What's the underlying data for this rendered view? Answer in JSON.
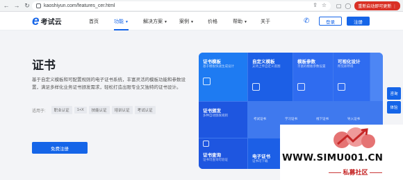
{
  "browser": {
    "url": "kaoshiyun.com/features_cer.html",
    "relaunch_label": "重新启动即可更新 ⋮"
  },
  "header": {
    "logo_mark": "e",
    "logo_text": "考试云",
    "nav": [
      "首页",
      "功能",
      "解决方案",
      "案例",
      "价格",
      "帮助",
      "关于"
    ],
    "active_nav": "功能",
    "login_label": "登录",
    "register_label": "注册"
  },
  "hero": {
    "title": "证书",
    "description": "基于自定义模板和可配置规则的电子证书系统，丰富灵活的模板功能和参数设置，满足多样化业务证书颁发需求，轻松打造出限专业又独特的证书设计。",
    "tags_label": "适用于:",
    "tags": [
      "职业认证",
      "1+X",
      "技能认证",
      "培训认证",
      "考试认证"
    ],
    "cta_label": "免费注册"
  },
  "tiles": {
    "cert_template": {
      "title": "证书模板",
      "subtitle": "基于模板快速生成设计"
    },
    "custom_template": {
      "title": "自定义模板",
      "subtitle": "支持上传自定义底图"
    },
    "template_params": {
      "title": "模板参数",
      "subtitle": "丰富的模板参数设置"
    },
    "visual_design": {
      "title": "可视化设计",
      "subtitle": "所见即所得"
    },
    "cert_issue": {
      "title": "证书颁发",
      "subtitle": "多种自动颁发规则"
    },
    "exam_cert": {
      "label": "考试证书"
    },
    "study_cert": {
      "label": "学习证书"
    },
    "offline_cert": {
      "label": "线下证书"
    },
    "import_cert": {
      "label": "导入证书"
    },
    "cert_query": {
      "title": "证书查询",
      "subtitle": "证书可查询可验证"
    },
    "e_cert": {
      "title": "电子证书",
      "subtitle": "证书可下载"
    }
  },
  "side_buttons": [
    "咨询",
    "体验"
  ],
  "watermark": {
    "text": "WWW.SIMU001.CN",
    "subtitle": "—— 私募社区 ——"
  },
  "colors": {
    "accent": "#1565e8",
    "tile_dark": "#1e56e0",
    "tile_mid": "#2f6cf0",
    "tile_light": "#4d86f4"
  }
}
